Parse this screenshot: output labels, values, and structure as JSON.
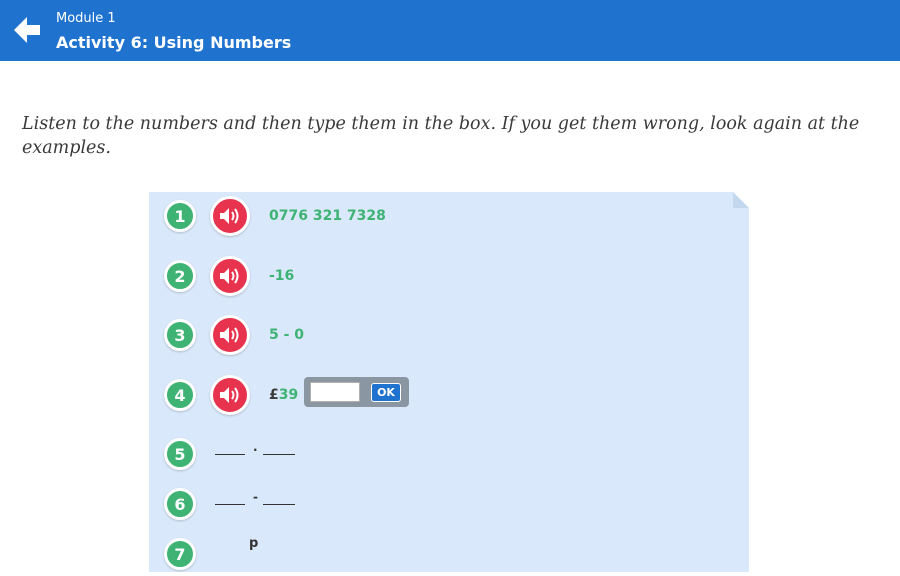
{
  "header": {
    "module_label": "Module 1",
    "activity_title": "Activity 6: Using Numbers",
    "back_icon": "arrow-left-icon",
    "background": "#1f73cf"
  },
  "instructions": "Listen to the numbers and then type them in the box. If you get them wrong, look again at the examples.",
  "items": [
    {
      "number": "1",
      "answer": "0776 321 7328"
    },
    {
      "number": "2",
      "answer": "-16"
    },
    {
      "number": "3",
      "answer": "5 - 0"
    },
    {
      "number": "4",
      "currency": "£",
      "value": "39",
      "separator": ".",
      "input_value": "",
      "ok_label": "OK"
    },
    {
      "number": "5",
      "separator": "."
    },
    {
      "number": "6",
      "separator": "-"
    },
    {
      "number": "7",
      "letter": "p"
    }
  ],
  "colors": {
    "badge": "#3eb373",
    "audio": "#e8334e",
    "card": "#d9e8fb",
    "answer_text": "#3eb373"
  }
}
